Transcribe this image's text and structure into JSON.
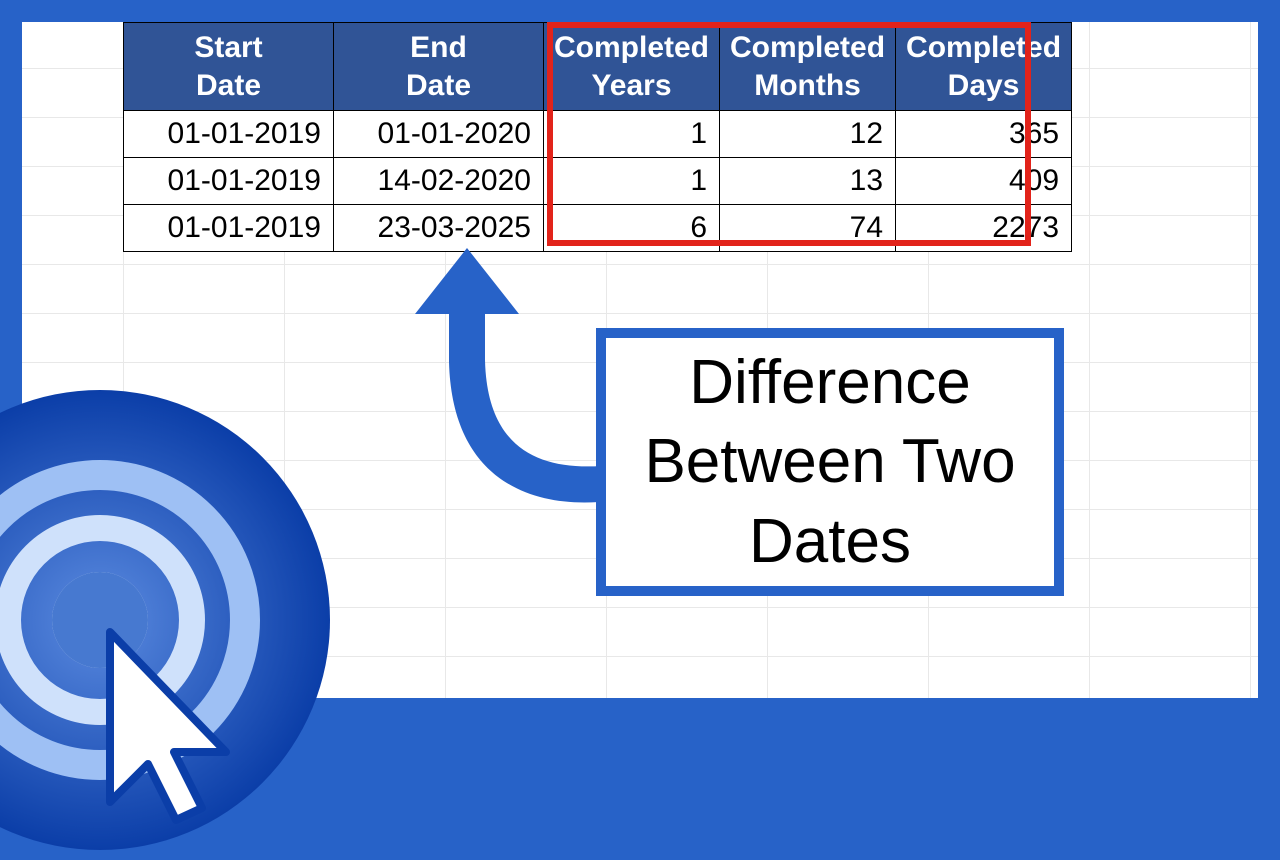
{
  "table": {
    "headers": {
      "start": "Start\nDate",
      "end": "End\nDate",
      "years": "Completed\nYears",
      "months": "Completed\nMonths",
      "days": "Completed\nDays"
    },
    "rows": [
      {
        "start": "01-01-2019",
        "end": "01-01-2020",
        "years": "1",
        "months": "12",
        "days": "365"
      },
      {
        "start": "01-01-2019",
        "end": "14-02-2020",
        "years": "1",
        "months": "13",
        "days": "409"
      },
      {
        "start": "01-01-2019",
        "end": "23-03-2025",
        "years": "6",
        "months": "74",
        "days": "2273"
      }
    ]
  },
  "callout": {
    "text": "Difference Between Two Dates"
  }
}
